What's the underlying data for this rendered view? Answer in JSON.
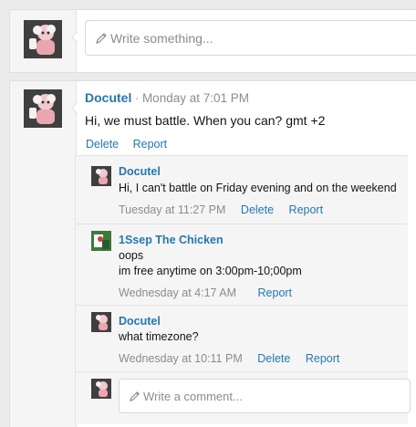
{
  "composer": {
    "placeholder": "Write something..."
  },
  "post": {
    "author": "Docutel",
    "separator": "·",
    "time": "Monday at 7:01 PM",
    "message": "Hi, we must battle. When you can? gmt +2",
    "actions": {
      "delete": "Delete",
      "report": "Report"
    }
  },
  "comments": [
    {
      "author": "Docutel",
      "lines": [
        "Hi, I can't battle on Friday evening and on the weekend"
      ],
      "time": "Tuesday at 11:27 PM",
      "delete": "Delete",
      "report": "Report"
    },
    {
      "author": "1Ssep The Chicken",
      "lines": [
        "oops",
        "im free anytime on 3:00pm-10;00pm"
      ],
      "time": "Wednesday at 4:17 AM",
      "report": "Report"
    },
    {
      "author": "Docutel",
      "lines": [
        "what timezone?"
      ],
      "time": "Wednesday at 10:11 PM",
      "delete": "Delete",
      "report": "Report"
    }
  ],
  "reply": {
    "placeholder": "Write a comment..."
  },
  "colors": {
    "link": "#2577b1",
    "muted": "#8c8c8c",
    "avatar_bg": "#4b4b4b",
    "panel": "#f5f5f5"
  },
  "icons": {
    "pen": "pencil-icon",
    "avatar_docutel": "cartoon-character-avatar",
    "avatar_chicken": "green-character-avatar"
  }
}
